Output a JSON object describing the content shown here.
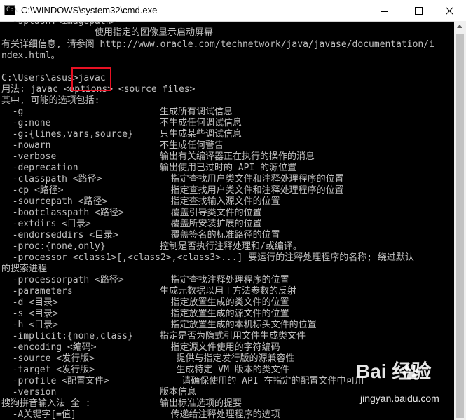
{
  "window": {
    "title": "C:\\WINDOWS\\system32\\cmd.exe",
    "icon": "cmd-icon"
  },
  "colors": {
    "background": "#000000",
    "text": "#c0c0c0",
    "highlight": "#e81123"
  },
  "lines": [
    {
      "a": "  -splash:<imagepath>"
    },
    {
      "a": "                 使用指定的图像显示启动屏幕"
    },
    {
      "a": "有关详细信息, 请参阅 http://www.oracle.com/technetwork/java/javase/documentation/i"
    },
    {
      "a": "ndex.html。"
    },
    {
      "a": ""
    },
    {
      "a": "C:\\Users\\asus>javac"
    },
    {
      "a": "用法: javac <options> <source files>"
    },
    {
      "a": "其中, 可能的选项包括:"
    },
    {
      "a": "  -g",
      "b": "生成所有调试信息"
    },
    {
      "a": "  -g:none",
      "b": "不生成任何调试信息"
    },
    {
      "a": "  -g:{lines,vars,source}",
      "b": "只生成某些调试信息"
    },
    {
      "a": "  -nowarn",
      "b": "不生成任何警告"
    },
    {
      "a": "  -verbose",
      "b": "输出有关编译器正在执行的操作的消息"
    },
    {
      "a": "  -deprecation",
      "b": "输出使用已过时的 API 的源位置"
    },
    {
      "a": "  -classpath <路径>",
      "b": "  指定查找用户类文件和注释处理程序的位置"
    },
    {
      "a": "  -cp <路径>",
      "b": "  指定查找用户类文件和注释处理程序的位置"
    },
    {
      "a": "  -sourcepath <路径>",
      "b": "  指定查找输入源文件的位置"
    },
    {
      "a": "  -bootclasspath <路径>",
      "b": "  覆盖引导类文件的位置"
    },
    {
      "a": "  -extdirs <目录>",
      "b": "  覆盖所安装扩展的位置"
    },
    {
      "a": "  -endorseddirs <目录>",
      "b": "  覆盖签名的标准路径的位置"
    },
    {
      "a": "  -proc:{none,only}",
      "b": "控制是否执行注释处理和/或编译。"
    },
    {
      "a": "  -processor <class1>[,<class2>,<class3>...] 要运行的注释处理程序的名称; 绕过默认"
    },
    {
      "a": "的搜索进程"
    },
    {
      "a": "  -processorpath <路径>",
      "b": "  指定查找注释处理程序的位置"
    },
    {
      "a": "  -parameters",
      "b": "生成元数据以用于方法参数的反射"
    },
    {
      "a": "  -d <目录>",
      "b": "  指定放置生成的类文件的位置"
    },
    {
      "a": "  -s <目录>",
      "b": "  指定放置生成的源文件的位置"
    },
    {
      "a": "  -h <目录>",
      "b": "  指定放置生成的本机标头文件的位置"
    },
    {
      "a": "  -implicit:{none,class}",
      "b": "指定是否为隐式引用文件生成类文件"
    },
    {
      "a": "  -encoding <编码>",
      "b": "  指定源文件使用的字符编码"
    },
    {
      "a": "  -source <发行版>",
      "b": "   提供与指定发行版的源兼容性"
    },
    {
      "a": "  -target <发行版>",
      "b": "   生成特定 VM 版本的类文件"
    },
    {
      "a": "  -profile <配置文件>",
      "b": "    请确保使用的 API 在指定的配置文件中可用"
    },
    {
      "a": "  -version",
      "b": "版本信息"
    },
    {
      "a": "搜狗拼音输入法 全 :",
      "b": "输出标准选项的提要"
    },
    {
      "a": "  -A关键字[=值]",
      "b": "  传递给注释处理程序的选项"
    }
  ],
  "watermark": {
    "logo": "Bai  经验",
    "url": "jingyan.baidu.com"
  }
}
